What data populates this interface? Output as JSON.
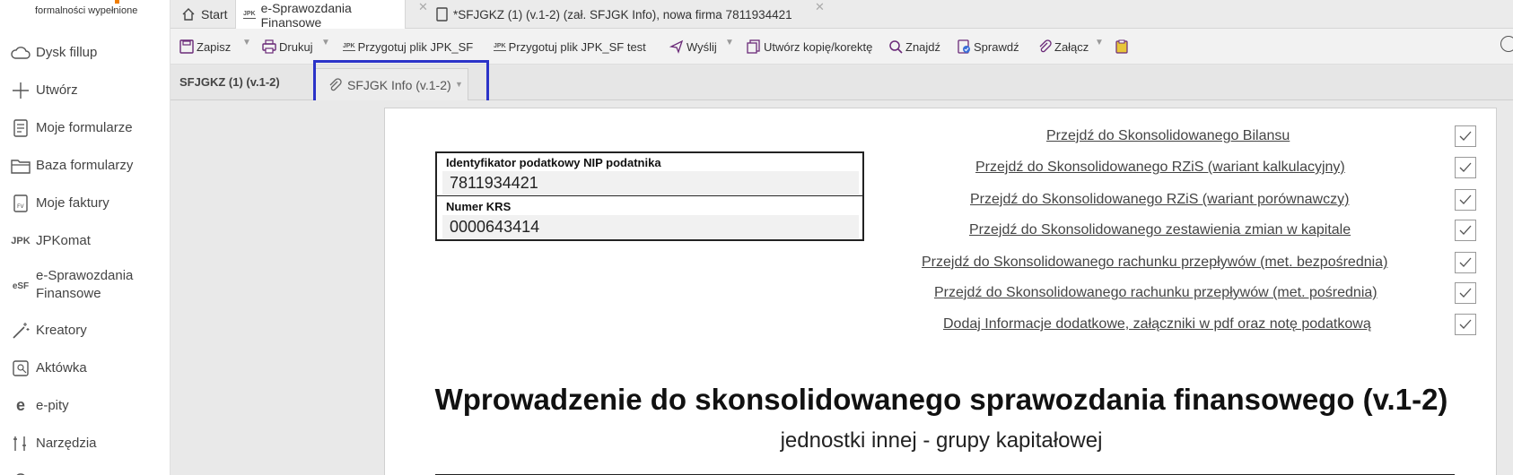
{
  "brand": {
    "tagline": "formalności wypełnione",
    "accent_color": "#f07d00"
  },
  "sidebar": {
    "items": [
      {
        "label": "Dysk fillup",
        "icon": "cloud-icon"
      },
      {
        "label": "Utwórz",
        "icon": "plus-icon"
      },
      {
        "label": "Moje formularze",
        "icon": "document-icon"
      },
      {
        "label": "Baza formularzy",
        "icon": "folder-icon"
      },
      {
        "label": "Moje faktury",
        "icon": "invoice-icon"
      },
      {
        "label": "JPKomat",
        "icon": "jpk-icon",
        "icon_text": "JPK"
      },
      {
        "label": "e-Sprawozdania Finansowe",
        "icon": "esf-icon",
        "icon_text": "eSF"
      },
      {
        "label": "Kreatory",
        "icon": "wand-icon"
      },
      {
        "label": "Aktówka",
        "icon": "briefcase-icon"
      },
      {
        "label": "e-pity",
        "icon": "epity-icon",
        "icon_text": "e"
      },
      {
        "label": "Narzędzia",
        "icon": "tools-icon"
      }
    ]
  },
  "tabs": [
    {
      "label": "Start",
      "icon": "home-icon"
    },
    {
      "label": "e-Sprawozdania Finansowe",
      "icon": "jpk-icon",
      "icon_text": "JPK"
    },
    {
      "label": "*SFJGKZ (1) (v.1-2) (zał. SFJGK Info), nowa firma 7811934421",
      "icon": "page-icon"
    }
  ],
  "toolbar": {
    "save": "Zapisz",
    "print": "Drukuj",
    "prepare_jpk": "Przygotuj plik JPK_SF",
    "prepare_jpk_test": "Przygotuj plik JPK_SF test",
    "send": "Wyślij",
    "copy": "Utwórz kopię/korektę",
    "find": "Znajdź",
    "check": "Sprawdź",
    "attach": "Załącz",
    "jpk_icon_text": "JPK"
  },
  "form_tabs": {
    "main_label": "SFJGKZ (1) (v.1-2)",
    "attachment_tab": "SFJGK Info (v.1-2)",
    "highlight_color": "#2b33c8"
  },
  "document": {
    "nip_label": "Identyfikator podatkowy NIP podatnika",
    "nip_value": "7811934421",
    "krs_label": "Numer KRS",
    "krs_value": "0000643414",
    "links": [
      "Przejdź do Skonsolidowanego Bilansu",
      "Przejdź do Skonsolidowanego RZiS (wariant kalkulacyjny)",
      "Przejdź do Skonsolidowanego RZiS (wariant porównawczy)",
      "Przejdź do Skonsolidowanego zestawienia zmian w kapitale",
      "Przejdź do Skonsolidowanego rachunku przepływów (met. bezpośrednia)",
      "Przejdź do Skonsolidowanego rachunku przepływów (met. pośrednia)",
      "Dodaj Informacje dodatkowe, załączniki w pdf oraz notę podatkową"
    ],
    "title": "Wprowadzenie do skonsolidowanego sprawozdania finansowego (v.1-2)",
    "subtitle": "jednostki innej - grupy kapitałowej"
  }
}
